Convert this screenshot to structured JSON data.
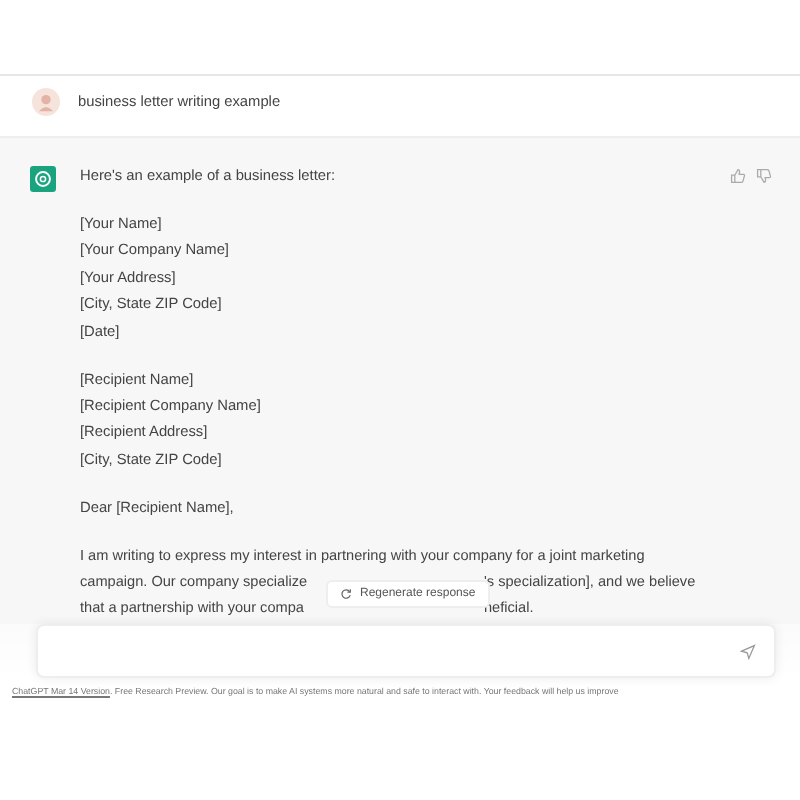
{
  "user_message": {
    "text": "business letter writing example"
  },
  "assistant_message": {
    "intro": "Here's an example of a business letter:",
    "sender_block": [
      "[Your Name]",
      "[Your Company Name]",
      "[Your Address]",
      "[City, State ZIP Code]",
      "[Date]"
    ],
    "recipient_block": [
      "[Recipient Name]",
      "[Recipient Company Name]",
      "[Recipient Address]",
      "[City, State ZIP Code]"
    ],
    "salutation": "Dear [Recipient Name],",
    "paragraph_lines": [
      {
        "parts": [
          "I am writing to express my interest in partnering with your company for a joint marketing"
        ]
      },
      {
        "parts": [
          "campaign. Our company specialize",
          "'s specialization], and we believe"
        ]
      },
      {
        "parts": [
          "that a partnership with your compa",
          "neficial."
        ]
      }
    ]
  },
  "regenerate_button": {
    "label": "Regenerate response"
  },
  "footer": {
    "link": "ChatGPT Mar 14 Version",
    "text": ". Free Research Preview. Our goal is to make AI systems more natural and safe to interact with. Your feedback will help us improve"
  }
}
